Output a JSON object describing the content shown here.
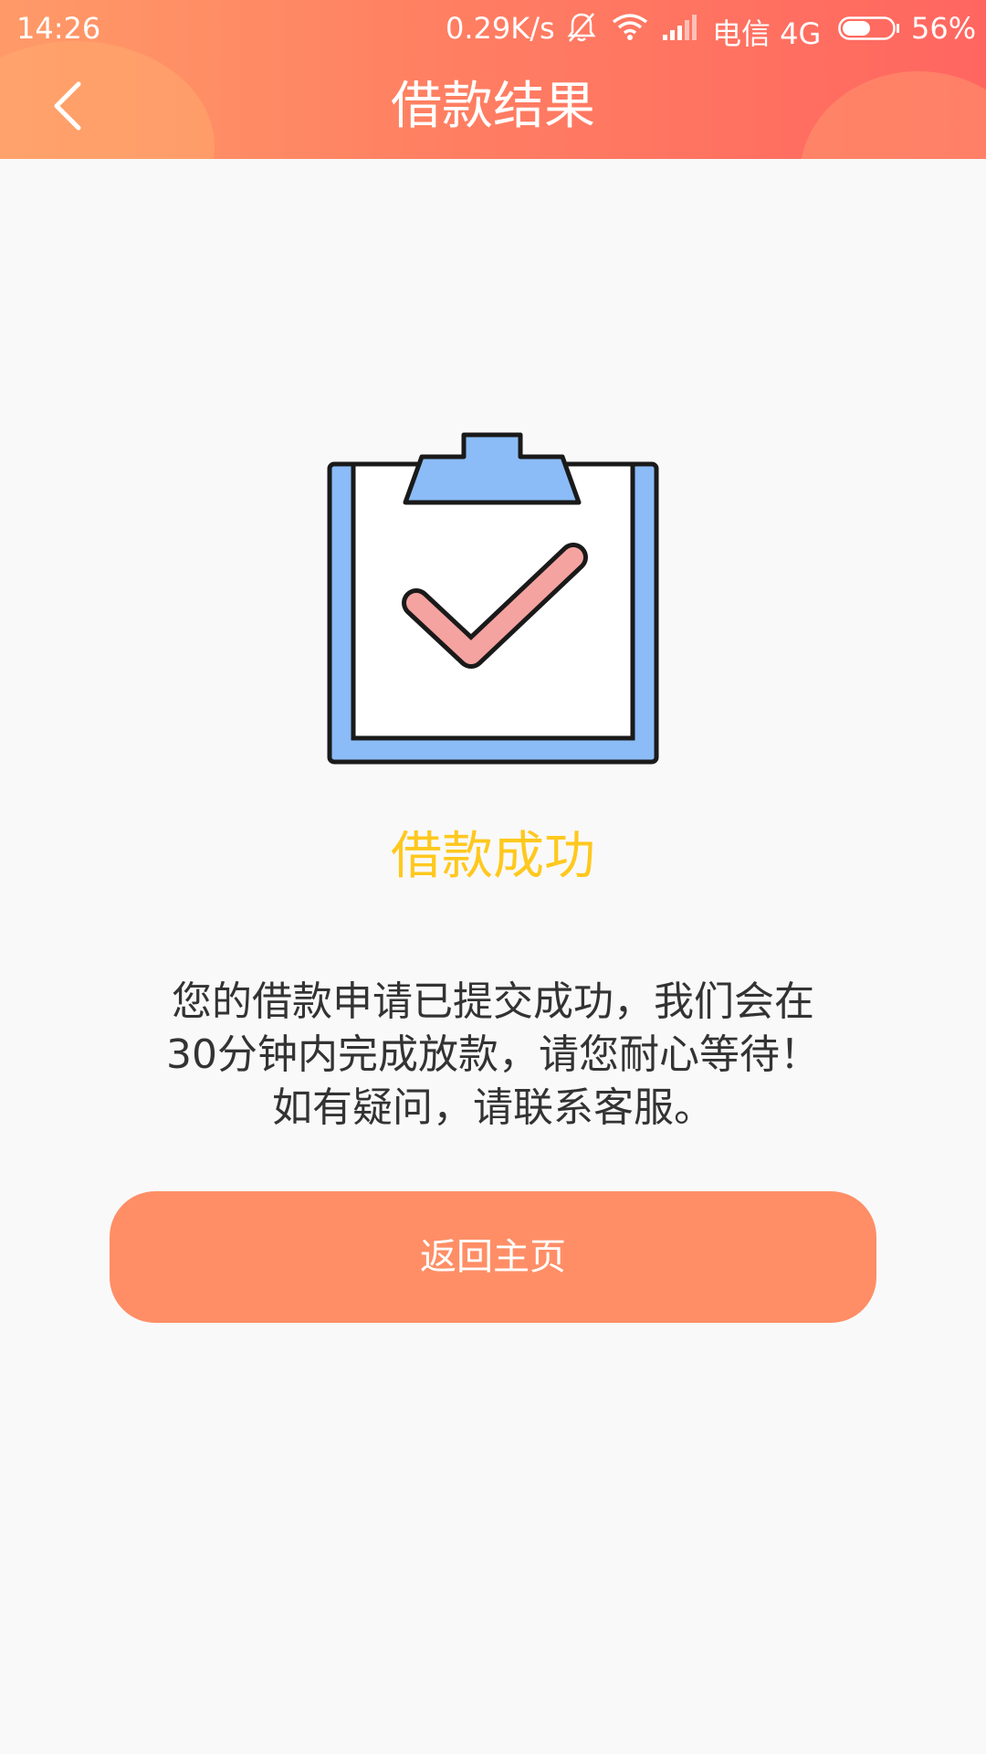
{
  "status_bar": {
    "time": "14:26",
    "network_speed": "0.29K/s",
    "carrier": "电信 4G",
    "battery_percent": "56%",
    "battery_level": 0.56,
    "icons": [
      "mute-bell-icon",
      "wifi-icon",
      "signal-icon",
      "battery-icon"
    ]
  },
  "header": {
    "title": "借款结果",
    "back_icon": "chevron-left-icon"
  },
  "result": {
    "icon": "clipboard-check-icon",
    "title": "借款成功",
    "message_lines": [
      "您的借款申请已提交成功，我们会在",
      "30分钟内完成放款，请您耐心等待！",
      "如有疑问，请联系客服。"
    ]
  },
  "actions": {
    "home_label": "返回主页"
  },
  "colors": {
    "header_gradient_start": "#ff9a68",
    "header_gradient_end": "#ff6660",
    "success_title": "#ffc81e",
    "button": "#ff8e66",
    "clipboard_frame": "#8bbcf7",
    "checkmark": "#f5a3a0"
  }
}
